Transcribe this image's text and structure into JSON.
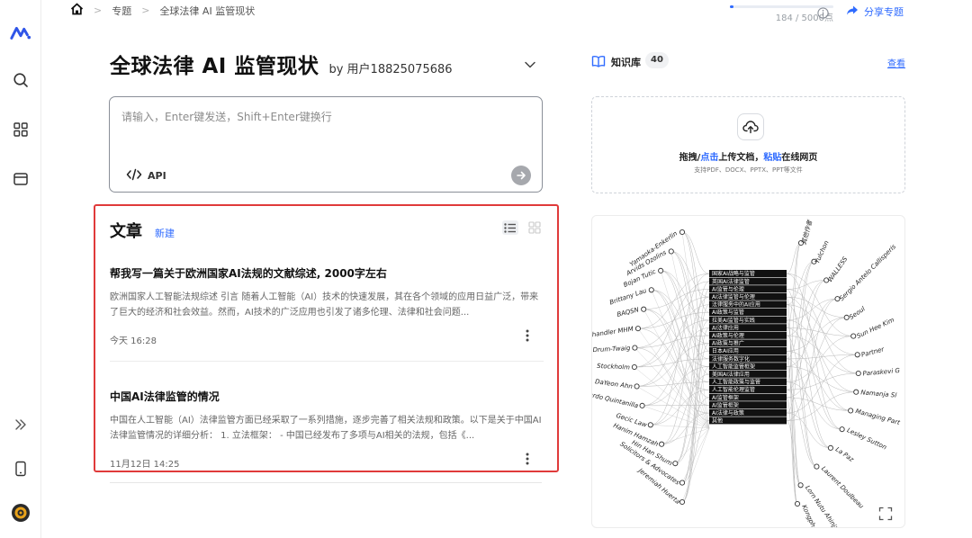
{
  "breadcrumb": {
    "home_icon": "home-icon",
    "items": [
      "专题",
      "全球法律 AI 监管现状"
    ]
  },
  "quota": {
    "used": 184,
    "total": 5000,
    "text": "184 / 5000点"
  },
  "share_label": "分享专题",
  "page": {
    "title": "全球法律 AI 监管现状",
    "by_user": "by 用户18825075686"
  },
  "input": {
    "placeholder": "请输入，Enter键发送，Shift+Enter键换行",
    "api_label": "API"
  },
  "articles": {
    "title": "文章",
    "new_label": "新建",
    "items": [
      {
        "title": "帮我写一篇关于欧洲国家AI法规的文献综述, 2000字左右",
        "desc": "欧洲国家人工智能法规综述 引言 随着人工智能（AI）技术的快速发展，其在各个领域的应用日益广泛，带来了巨大的经济和社会效益。然而，AI技术的广泛应用也引发了诸多伦理、法律和社会问题...",
        "time": "今天 16:28"
      },
      {
        "title": "中国AI法律监管的情况",
        "desc": "中国在人工智能（AI）法律监管方面已经采取了一系列措施，逐步完善了相关法规和政策。以下是关于中国AI法律监管情况的详细分析： 1. 立法框架： - 中国已经发布了多项与AI相关的法规，包括《...",
        "time": "11月12日 14:25"
      }
    ]
  },
  "knowledge": {
    "label": "知识库",
    "count": "40",
    "view_label": "查看",
    "upload_prefix": "拖拽/",
    "upload_click": "点击",
    "upload_middle": "上传文档，",
    "upload_paste": "粘贴",
    "upload_suffix": "在线网页",
    "upload_sub": "支持PDF、DOCX、PPTX、PPT等文件"
  },
  "graph": {
    "center_labels": [
      "国家AI战略与监管",
      "英国AI法律监管",
      "AI监管与伦理",
      "AI法律监管与伦理",
      "法律服务中的AI应用",
      "AI政策与监管",
      "拉美AI监管与实践",
      "AI法律应用",
      "AI政策与伦理",
      "AI政策与推广",
      "日本AI应用",
      "法律服务数字化",
      "人工智能监管框架",
      "美国AI法律应用",
      "人工智能政策与监管",
      "人工智能伦理监管",
      "AI监管框架",
      "AI监管框架",
      "AI法律与政策",
      "其他"
    ],
    "left_names": [
      "Yamaoka-Enkerlin",
      "Arvids Ozolins",
      "Bojan Tutic",
      "Brittany Lau",
      "BAQSN",
      "Chandler MHM",
      "Drum-Twaig",
      "Stockholm",
      "DaYeon Ahn",
      "Ricardo Quintanilla",
      "Gecic Law",
      "Hanim Hamzah",
      "Hin Han Shum",
      "Solicitors & Advocates",
      "Jeremiah Huerta"
    ],
    "right_names": [
      "其他作者",
      "Yulchon",
      "WALLESS",
      "Sergio Antelo Callisperis",
      "Seoul",
      "Sun Hee Kim",
      "Partner",
      "Paraskevi G",
      "Namanja Sl",
      "Managing Part",
      "Lesley Sutton",
      "La Paz",
      "Laurent Doulbeau",
      "Lorn Nutu Ahinjah",
      "Kongphop Jinacho"
    ]
  }
}
